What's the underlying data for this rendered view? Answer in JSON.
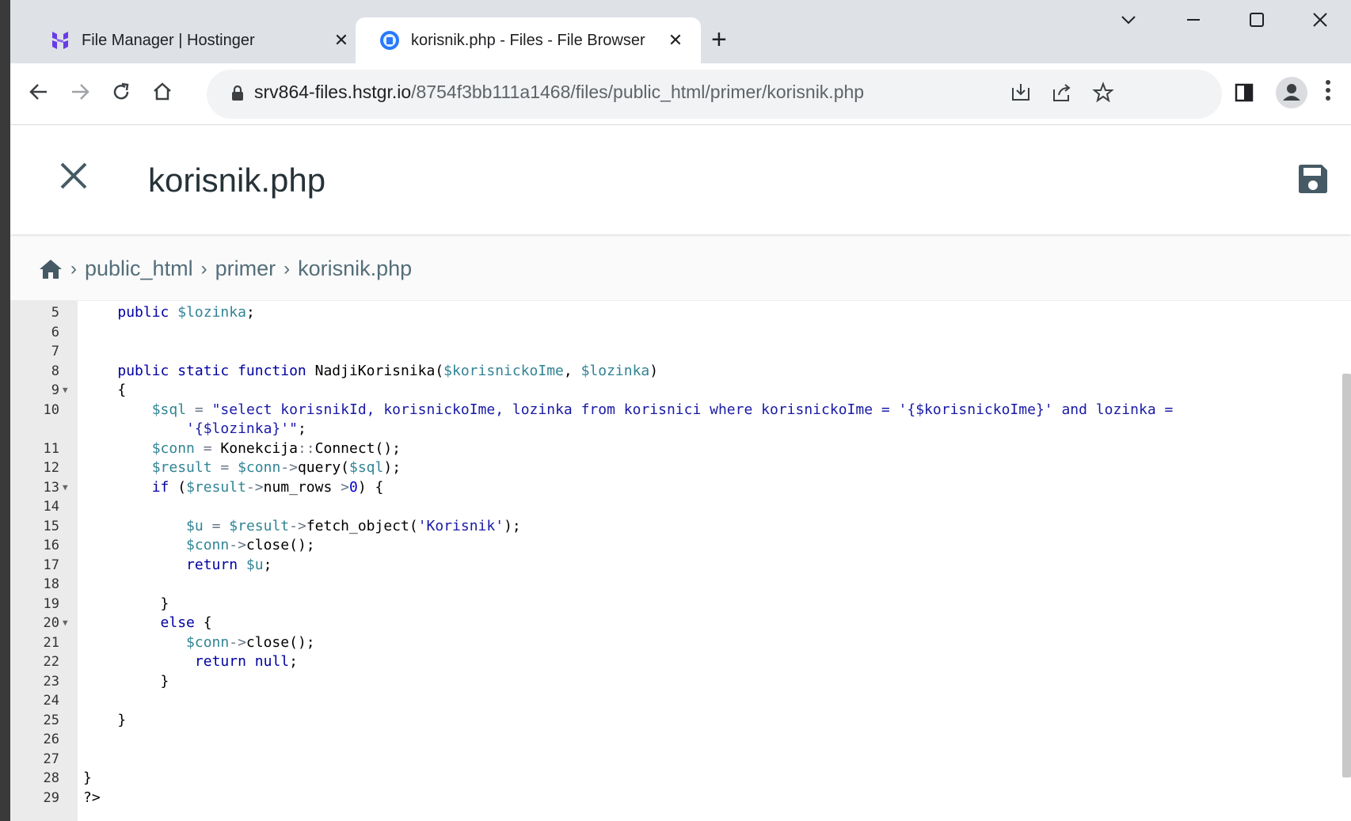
{
  "browser": {
    "tabs": [
      {
        "title": "File Manager | Hostinger",
        "active": false
      },
      {
        "title": "korisnik.php - Files - File Browser",
        "active": true
      }
    ],
    "url_host": "srv864-files.hstgr.io",
    "url_path": "/8754f3bb111a1468/files/public_html/primer/korisnik.php"
  },
  "editor": {
    "file_name": "korisnik.php"
  },
  "breadcrumb": {
    "items": [
      "public_html",
      "primer",
      "korisnik.php"
    ]
  },
  "code": {
    "line_numbers": [
      "5",
      "6",
      "7",
      "8",
      "9",
      "10",
      "",
      "11",
      "12",
      "13",
      "14",
      "15",
      "16",
      "17",
      "18",
      "19",
      "20",
      "21",
      "22",
      "23",
      "24",
      "25",
      "26",
      "27",
      "28",
      "29"
    ],
    "folded_lines": [
      "9",
      "13",
      "20"
    ]
  },
  "colors": {
    "keyword": "#0000a2",
    "variable": "#318495",
    "string": "#1a1aa6",
    "gutter": "#ebebeb",
    "tabbar": "#dee1e6"
  }
}
